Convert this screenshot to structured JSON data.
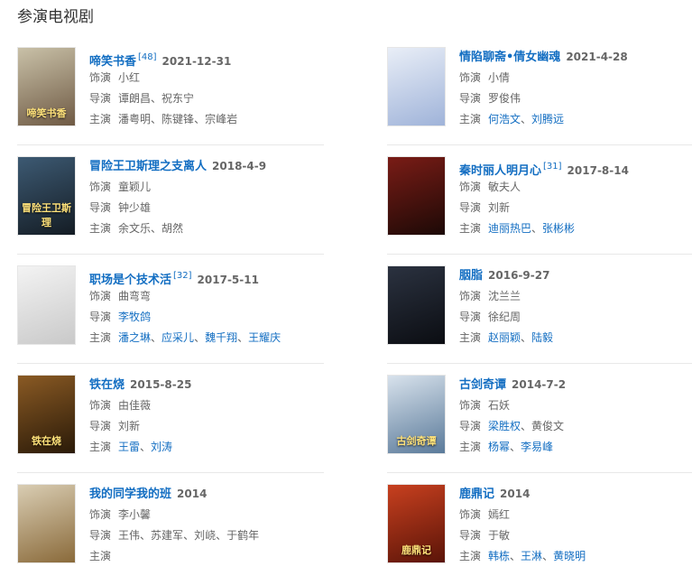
{
  "section_title": "参演电视剧",
  "items": [
    {
      "title": "啼笑书香",
      "sup": "[48]",
      "year": "2021-12-31",
      "poster_colors": [
        "#c9c1a8",
        "#6f5a44"
      ],
      "poster_text": "啼笑书香",
      "role_label": "饰演",
      "role": "小红",
      "director_label": "导演",
      "directors": [
        {
          "name": "谭朗昌",
          "link": false
        },
        {
          "name": "祝东宁",
          "link": false
        }
      ],
      "cast_label": "主演",
      "cast": [
        {
          "name": "潘粤明",
          "link": false
        },
        {
          "name": "陈键锋",
          "link": false
        },
        {
          "name": "宗峰岩",
          "link": false
        }
      ]
    },
    {
      "title": "情陷聊斋•倩女幽魂",
      "sup": "",
      "year": "2021-4-28",
      "poster_colors": [
        "#e9eef7",
        "#9fb3d9"
      ],
      "poster_text": "",
      "role_label": "饰演",
      "role": "小倩",
      "director_label": "导演",
      "directors": [
        {
          "name": "罗俊伟",
          "link": false
        }
      ],
      "cast_label": "主演",
      "cast": [
        {
          "name": "何浩文",
          "link": true
        },
        {
          "name": "刘腾远",
          "link": true
        }
      ]
    },
    {
      "title": "冒险王卫斯理之支离人",
      "sup": "",
      "year": "2018-4-9",
      "poster_colors": [
        "#3d5a73",
        "#141c24"
      ],
      "poster_text": "冒险王卫斯理",
      "role_label": "饰演",
      "role": "童颖儿",
      "director_label": "导演",
      "directors": [
        {
          "name": "钟少雄",
          "link": false
        }
      ],
      "cast_label": "主演",
      "cast": [
        {
          "name": "余文乐",
          "link": false
        },
        {
          "name": "胡然",
          "link": false
        }
      ]
    },
    {
      "title": "秦时丽人明月心",
      "sup": "[31]",
      "year": "2017-8-14",
      "poster_colors": [
        "#7a1c16",
        "#1c0906"
      ],
      "poster_text": "",
      "role_label": "饰演",
      "role": "敏夫人",
      "director_label": "导演",
      "directors": [
        {
          "name": "刘新",
          "link": false
        }
      ],
      "cast_label": "主演",
      "cast": [
        {
          "name": "迪丽热巴",
          "link": true
        },
        {
          "name": "张彬彬",
          "link": true
        }
      ]
    },
    {
      "title": "职场是个技术活",
      "sup": "[32]",
      "year": "2017-5-11",
      "poster_colors": [
        "#f3f3f3",
        "#c9c9c9"
      ],
      "poster_text": "",
      "role_label": "饰演",
      "role": "曲弯弯",
      "director_label": "导演",
      "directors": [
        {
          "name": "李牧鸽",
          "link": true
        }
      ],
      "cast_label": "主演",
      "cast": [
        {
          "name": "潘之琳",
          "link": true
        },
        {
          "name": "应采儿",
          "link": true
        },
        {
          "name": "魏千翔",
          "link": true
        },
        {
          "name": "王耀庆",
          "link": true
        }
      ]
    },
    {
      "title": "胭脂",
      "sup": "",
      "year": "2016-9-27",
      "poster_colors": [
        "#2b3240",
        "#0b0d12"
      ],
      "poster_text": "",
      "role_label": "饰演",
      "role": "沈兰兰",
      "director_label": "导演",
      "directors": [
        {
          "name": "徐纪周",
          "link": false
        }
      ],
      "cast_label": "主演",
      "cast": [
        {
          "name": "赵丽颖",
          "link": true
        },
        {
          "name": "陆毅",
          "link": true
        }
      ]
    },
    {
      "title": "铁在烧",
      "sup": "",
      "year": "2015-8-25",
      "poster_colors": [
        "#8a5a24",
        "#2a1a08"
      ],
      "poster_text": "铁在烧",
      "role_label": "饰演",
      "role": "由佳薇",
      "director_label": "导演",
      "directors": [
        {
          "name": "刘新",
          "link": false
        }
      ],
      "cast_label": "主演",
      "cast": [
        {
          "name": "王雷",
          "link": true
        },
        {
          "name": "刘涛",
          "link": true
        }
      ]
    },
    {
      "title": "古剑奇谭",
      "sup": "",
      "year": "2014-7-2",
      "poster_colors": [
        "#d8e2ec",
        "#5a7a9a"
      ],
      "poster_text": "古剑奇谭",
      "role_label": "饰演",
      "role": "石妖",
      "director_label": "导演",
      "directors": [
        {
          "name": "梁胜权",
          "link": true
        },
        {
          "name": "黄俊文",
          "link": false
        }
      ],
      "cast_label": "主演",
      "cast": [
        {
          "name": "杨幂",
          "link": true
        },
        {
          "name": "李易峰",
          "link": true
        }
      ]
    },
    {
      "title": "我的同学我的班",
      "sup": "",
      "year": "2014",
      "poster_colors": [
        "#d9cdb3",
        "#8a6a3a"
      ],
      "poster_text": "",
      "role_label": "饰演",
      "role": "李小馨",
      "director_label": "导演",
      "directors": [
        {
          "name": "王伟",
          "link": false
        },
        {
          "name": "苏建军",
          "link": false
        },
        {
          "name": "刘峣",
          "link": false
        },
        {
          "name": "于鹤年",
          "link": false
        }
      ],
      "cast_label": "主演",
      "cast": []
    },
    {
      "title": "鹿鼎记",
      "sup": "",
      "year": "2014",
      "poster_colors": [
        "#c8401f",
        "#5a1408"
      ],
      "poster_text": "鹿鼎记",
      "role_label": "饰演",
      "role": "嫣红",
      "director_label": "导演",
      "directors": [
        {
          "name": "于敏",
          "link": false
        }
      ],
      "cast_label": "主演",
      "cast": [
        {
          "name": "韩栋",
          "link": true
        },
        {
          "name": "王淋",
          "link": true
        },
        {
          "name": "黄晓明",
          "link": true
        }
      ]
    }
  ]
}
